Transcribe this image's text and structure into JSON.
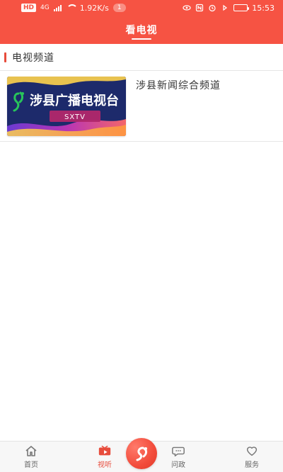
{
  "status_bar": {
    "hd_label": "HD",
    "network_label": "4G",
    "net_speed": "1.92K/s",
    "notif_count": "1",
    "battery_label": "",
    "time": "15:53"
  },
  "header": {
    "tab_title": "看电视"
  },
  "section": {
    "title": "电视频道"
  },
  "channels": [
    {
      "name": "涉县新闻综合频道",
      "thumb_title": "涉县广播电视台",
      "thumb_subtitle": "SXTV"
    }
  ],
  "bottom_nav": {
    "items": [
      {
        "label": "首页",
        "icon": "home-icon"
      },
      {
        "label": "视听",
        "icon": "video-icon"
      },
      {
        "label": "问政",
        "icon": "chat-icon"
      },
      {
        "label": "服务",
        "icon": "heart-icon"
      }
    ],
    "center_icon": "logo-icon"
  },
  "colors": {
    "primary": "#f65343",
    "accent": "#e74c3c"
  }
}
